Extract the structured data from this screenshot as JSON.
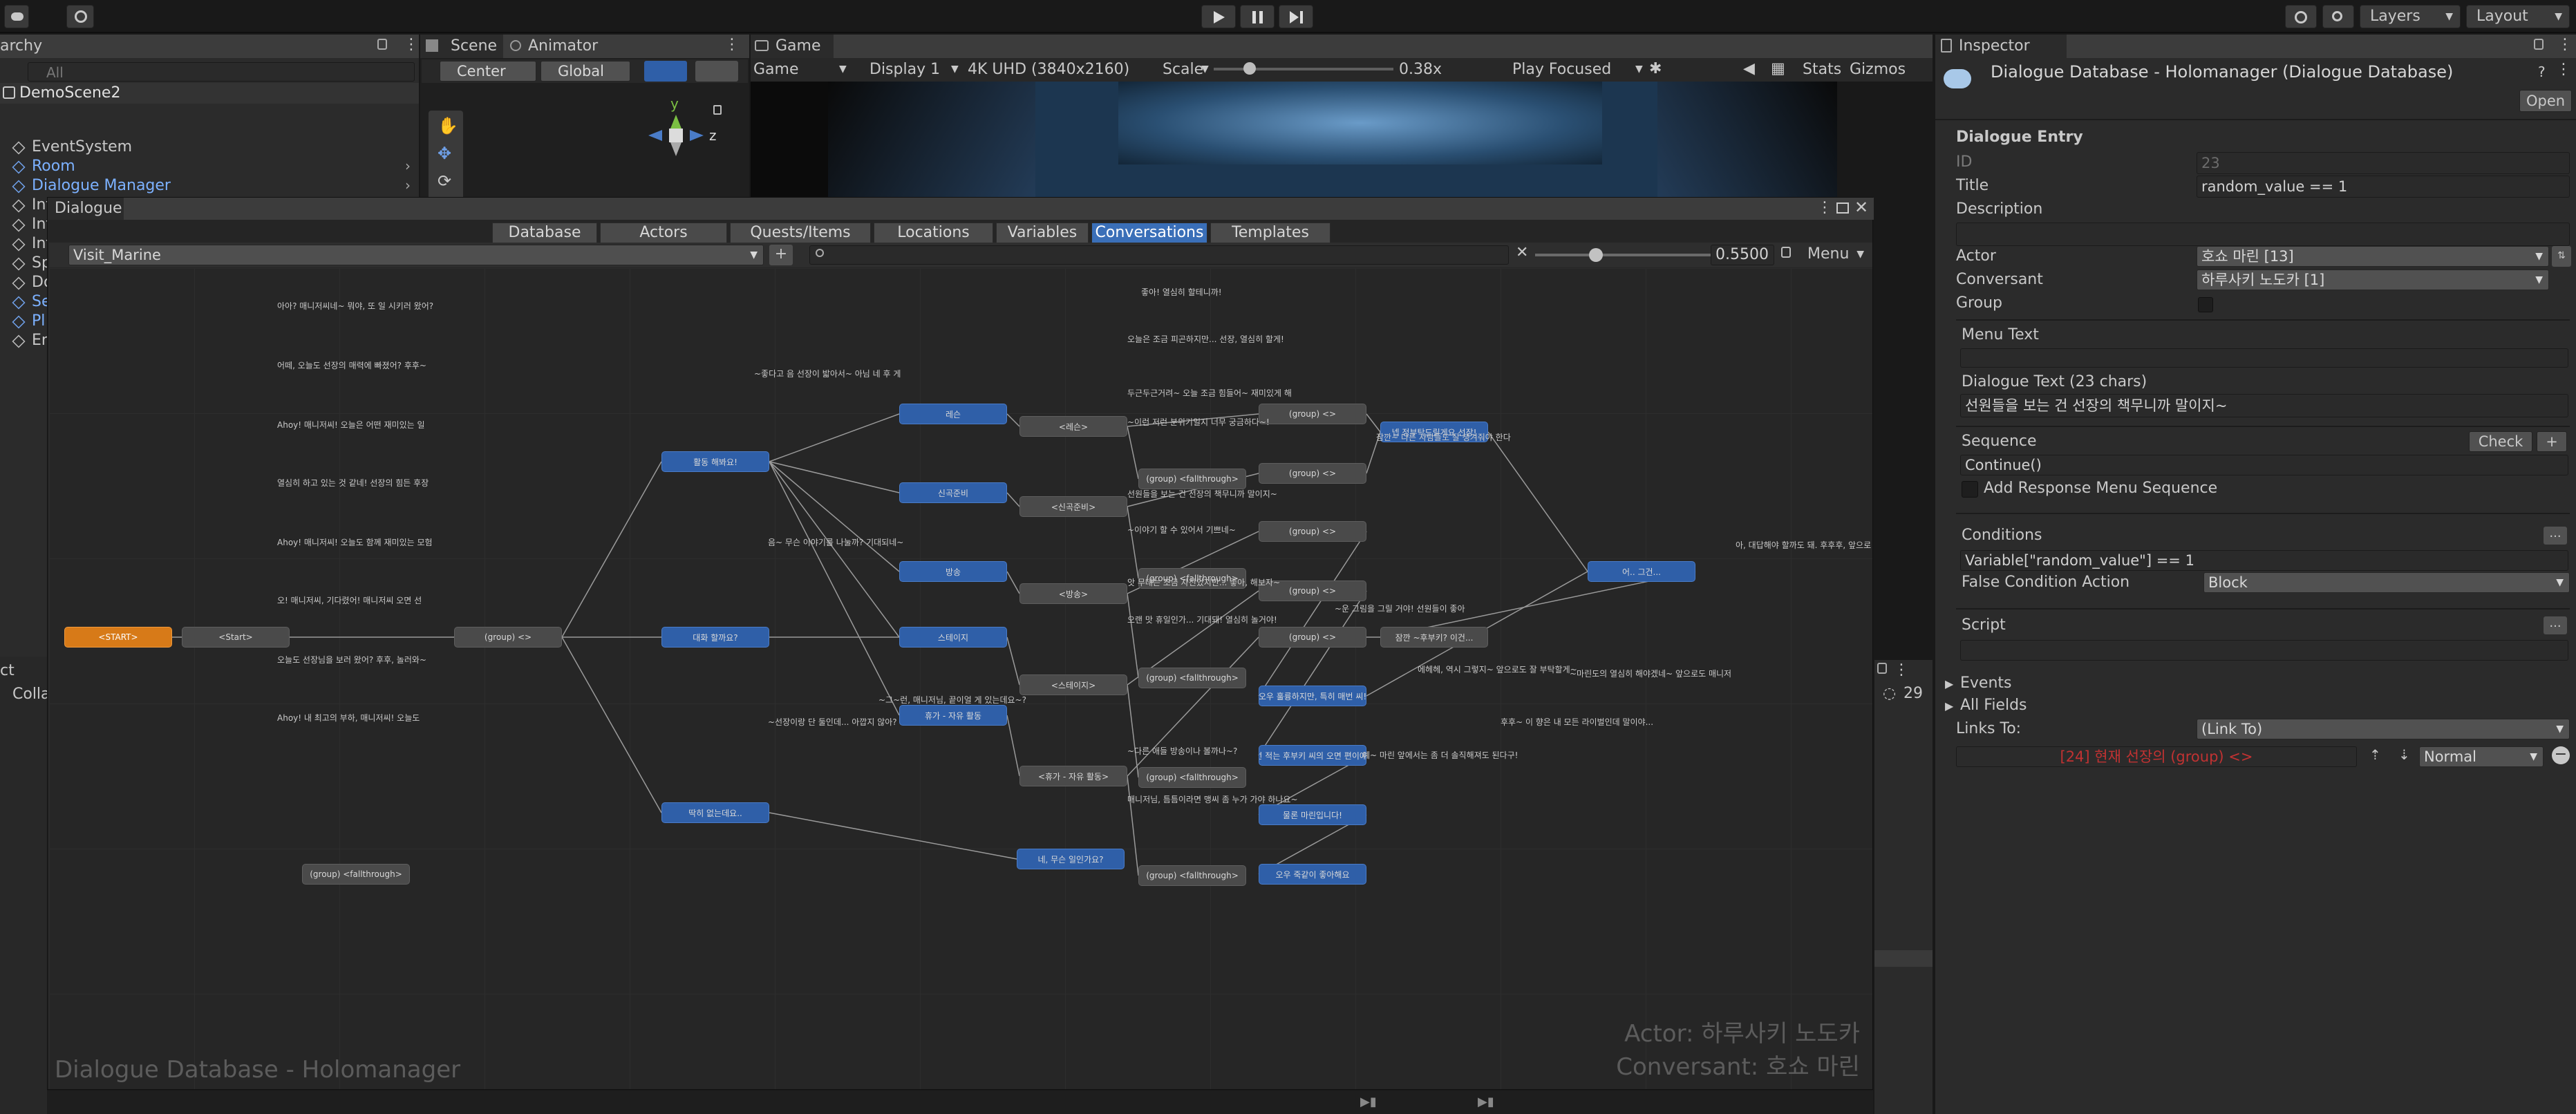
{
  "colors": {
    "accent_blue": "#2f5fa8",
    "start_orange": "#d77a18",
    "panel": "#2b2b2b",
    "background": "#191919",
    "link_red": "#c13232"
  },
  "toolbar": {
    "icons": [
      "cloud-icon",
      "collab-icon",
      "play-icon",
      "pause-icon",
      "step-icon",
      "history-icon",
      "search-icon"
    ],
    "layers_label": "Layers",
    "layout_label": "Layout"
  },
  "hierarchy": {
    "title": "archy",
    "search_placeholder": "All",
    "scene_name": "DemoScene2",
    "items": [
      {
        "label": "EventSystem",
        "blue": false
      },
      {
        "label": "Room",
        "blue": true
      },
      {
        "label": "Dialogue Manager",
        "blue": true
      },
      {
        "label": "Info: Bark Groups",
        "blue": false
      },
      {
        "label": "Info: Increment On Destroy",
        "blue": false
      },
      {
        "label": "Inf",
        "blue": false
      },
      {
        "label": "Sp",
        "blue": false
      },
      {
        "label": "Do",
        "blue": false
      },
      {
        "label": "Se",
        "blue": true
      },
      {
        "label": "Pl",
        "blue": true
      },
      {
        "label": "En",
        "blue": false
      }
    ]
  },
  "scene_view": {
    "tabs": [
      "Scene",
      "Animator"
    ],
    "pivot_label": "Center",
    "space_label": "Global",
    "axis_y": "y",
    "axis_z": "z"
  },
  "game_view": {
    "tab": "Game",
    "mode": "Game",
    "display": "Display 1",
    "resolution": "4K UHD (3840x2160)",
    "scale_label": "Scale",
    "scale_value": "0.38x",
    "scale_fraction": 0.2,
    "play_mode": "Play Focused",
    "stats": "Stats",
    "gizmos": "Gizmos"
  },
  "dialogue_editor": {
    "title": "Dialogue",
    "tabs": [
      "Database",
      "Actors",
      "Quests/Items",
      "Locations",
      "Variables",
      "Conversations",
      "Templates"
    ],
    "active_tab": "Conversations",
    "conversation": "Visit_Marine",
    "zoom": "0.5500",
    "zoom_fraction": 0.27,
    "menu_label": "Menu",
    "watermark": "Dialogue Database - Holomanager",
    "actor_label": "Actor: 하루사키 노도카",
    "conversant_label": "Conversant: 호쇼 마린",
    "nodes": [
      {
        "t": "<START>",
        "kind": "orange"
      },
      {
        "t": "<Start>",
        "kind": "gray"
      },
      {
        "t": "(group) <>",
        "kind": "gray"
      },
      {
        "t": "(group) <fallthrough>",
        "kind": "gray"
      },
      {
        "t": "활동 해봐요!",
        "kind": "blue"
      },
      {
        "t": "대화 할까요?",
        "kind": "blue"
      },
      {
        "t": "딱히 없는데요..",
        "kind": "blue"
      },
      {
        "t": "레슨",
        "kind": "blue"
      },
      {
        "t": "신곡준비",
        "kind": "blue"
      },
      {
        "t": "방송",
        "kind": "blue"
      },
      {
        "t": "스테이지",
        "kind": "blue"
      },
      {
        "t": "휴가 - 자유 활동",
        "kind": "blue"
      },
      {
        "t": "네, 무슨 일인가요?",
        "kind": "blue"
      },
      {
        "t": "<레슨>",
        "kind": "gray"
      },
      {
        "t": "<신곡준비>",
        "kind": "gray"
      },
      {
        "t": "<방송>",
        "kind": "gray"
      },
      {
        "t": "<스테이지>",
        "kind": "gray"
      },
      {
        "t": "<휴가 - 자유 활동>",
        "kind": "gray"
      },
      {
        "t": "(group) <fallthrough>",
        "kind": "gray"
      },
      {
        "t": "(group) <fallthrough>",
        "kind": "gray"
      },
      {
        "t": "(group) <fallthrough>",
        "kind": "gray"
      },
      {
        "t": "(group) <fallthrough>",
        "kind": "gray"
      },
      {
        "t": "(group) <fallthrough>",
        "kind": "gray"
      },
      {
        "t": "(group) <>",
        "kind": "gray"
      },
      {
        "t": "(group) <>",
        "kind": "gray"
      },
      {
        "t": "(group) <>",
        "kind": "gray"
      },
      {
        "t": "(group) <>",
        "kind": "gray"
      },
      {
        "t": "(group) <>",
        "kind": "gray"
      },
      {
        "t": "넵 정부탁드릴게요 선장!",
        "kind": "blue"
      },
      {
        "t": "오우 훌륭하지만, 특히 매번 씨!",
        "kind": "blue"
      },
      {
        "t": "시선 적는 후부키 씨의 오면 편이에요!",
        "kind": "blue"
      },
      {
        "t": "물론 마린입니다!",
        "kind": "blue"
      },
      {
        "t": "오우 죽같이 좋아해요",
        "kind": "blue"
      },
      {
        "t": "어.. 그건...",
        "kind": "blue"
      },
      {
        "t": "잠깐 ~후부키? 이건...",
        "kind": "gray"
      }
    ],
    "texts": [
      "아아? 매니저씨네~ 뭐야, 또 일 시키러 왔어?",
      "어떼, 오늘도 선장의 매력에 빠졌어? 후후~",
      "Ahoy! 매니저씨! 오늘은 어떤 재미있는 일",
      "열심히 하고 있는 것 같네! 선장의 힘든 후장",
      "Ahoy! 매니저씨! 오늘도 함께 재미있는 모험",
      "오! 매니저씨, 기다렸어! 매니저씨 오면 선",
      "오늘도 선장님을 보러 왔어? 후후, 놀러와~",
      "Ahoy! 내 최고의 부하, 매니저씨! 오늘도",
      "~좋다고 음 선장이 밟아서~ 아님 네 후 게",
      "음~ 무슨 이야기를 나눌까? 기대되네~",
      "~선장이랑 단 둘인데... 아깝지 않아?",
      "~그~런, 매니저님, 끝이얼 게 있는데요~?",
      "좋아! 열심히 할테니까!",
      "오늘은 조금 피곤하지만... 선장, 열심히 할게!",
      "두근두근거려~ 오늘 조금 힘들어~ 재미있게 해",
      "~이런 저런 분위기일지 너무 궁금하다~!",
      "선원들을 보는 건 선장의 책무니까 말이지~",
      "~이야기 할 수 있어서 기쁘네~",
      "앗 무대는 조금 자신있지만... 좋아, 해보자~",
      "오랜 맛 휴일인가... 기대돼! 열심히 놀거야!",
      "~다른 애들 방송이나 볼까나~?",
      "매니저님, 틈틈이라면 맹씨 좀 누가 가야 하나요~",
      "~운 그림을 그릴 거야! 선원들이 좋아",
      "에헤헤, 역시 그렇지~ 앞으로도 잘 부탁할게~",
      "잠깐~ 다른 사람들도 잘 챙겨줘야 한다",
      "~마린도의 열심히 해야겠네~ 앞으로도 매니저",
      "후후~ 이 향은 내 모든 라이벌인데 말이야...",
      "예~ 마린 앞에서는 좀 더 솔직해져도 된다구!",
      "아, 대답해야 할까도 돼. 후후후, 앞으로 남에"
    ]
  },
  "inspector": {
    "tab": "Inspector",
    "object_title": "Dialogue Database - Holomanager (Dialogue Database)",
    "open_button": "Open",
    "section": "Dialogue Entry",
    "id_label": "ID",
    "id_value": "23",
    "title_label": "Title",
    "title_value": "random_value == 1",
    "description_label": "Description",
    "actor_label": "Actor",
    "actor_value": "호쇼 마린 [13]",
    "conversant_label": "Conversant",
    "conversant_value": "하루사키 노도카 [1]",
    "group_label": "Group",
    "menu_text_label": "Menu Text",
    "dialogue_text_label": "Dialogue Text (23 chars)",
    "dialogue_text_value": "선원들을 보는 건 선장의 책무니까 말이지~",
    "sequence_label": "Sequence",
    "check_button": "Check",
    "plus_button": "+",
    "sequence_value": "Continue()",
    "add_response_label": "Add Response Menu Sequence",
    "conditions_label": "Conditions",
    "more_button": "...",
    "conditions_value": "Variable[\"random_value\"] == 1",
    "false_condition_label": "False Condition Action",
    "false_condition_value": "Block",
    "script_label": "Script",
    "events_label": "Events",
    "all_fields_label": "All Fields",
    "links_to_label": "Links To:",
    "links_to_value": "(Link To)",
    "link_entry": "[24] 현재 선장의 (group) <>",
    "link_priority": "Normal"
  },
  "bottom_panel": {
    "left_label": "ct",
    "collapse_label": "Colla",
    "counter": "29"
  }
}
